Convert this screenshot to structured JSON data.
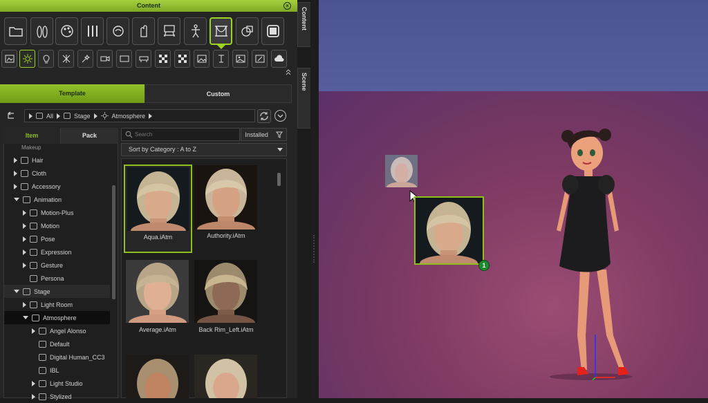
{
  "window": {
    "title": "Content"
  },
  "side_tabs": [
    "Content",
    "Scene"
  ],
  "category_icons": [
    "folder-icon",
    "bowling-pins-icon",
    "palette-icon",
    "brushes-icon",
    "head-profile-icon",
    "hand-icon",
    "stage-icon",
    "stick-figure-icon",
    "stage-frame-icon",
    "shapes-icon",
    "square-frame-icon"
  ],
  "sub_icons": [
    "scene-icon",
    "sun-icon",
    "lamp-icon",
    "sparkle-icon",
    "effects-icon",
    "camera-icon",
    "screen-icon",
    "props-icon",
    "checker-icon",
    "checker-icon",
    "image-icon",
    "text-icon",
    "image-icon",
    "edit-image-icon",
    "cloud-icon"
  ],
  "tabs": {
    "template": "Template",
    "custom": "Custom"
  },
  "breadcrumb": [
    "All",
    "Stage",
    "Atmosphere"
  ],
  "left_tabs": {
    "item": "Item",
    "pack": "Pack"
  },
  "search": {
    "placeholder": "Search",
    "installed": "Installed"
  },
  "sort": {
    "label": "Sort by Category : A to Z"
  },
  "tree": {
    "partial_top": "Makeup",
    "items": [
      {
        "label": "Hair",
        "depth": 0,
        "state": "collapsed"
      },
      {
        "label": "Cloth",
        "depth": 0,
        "state": "collapsed"
      },
      {
        "label": "Accessory",
        "depth": 0,
        "state": "collapsed"
      },
      {
        "label": "Animation",
        "depth": 0,
        "state": "expanded"
      },
      {
        "label": "Motion-Plus",
        "depth": 1,
        "state": "collapsed"
      },
      {
        "label": "Motion",
        "depth": 1,
        "state": "collapsed"
      },
      {
        "label": "Pose",
        "depth": 1,
        "state": "collapsed"
      },
      {
        "label": "Expression",
        "depth": 1,
        "state": "collapsed"
      },
      {
        "label": "Gesture",
        "depth": 1,
        "state": "collapsed"
      },
      {
        "label": "Persona",
        "depth": 1,
        "state": "none"
      },
      {
        "label": "Stage",
        "depth": 0,
        "state": "expanded"
      },
      {
        "label": "Light Room",
        "depth": 1,
        "state": "collapsed"
      },
      {
        "label": "Atmosphere",
        "depth": 1,
        "state": "expanded",
        "selected": true
      },
      {
        "label": "Angel Alonso",
        "depth": 2,
        "state": "collapsed"
      },
      {
        "label": "Default",
        "depth": 2,
        "state": "none"
      },
      {
        "label": "Digital Human_CC3",
        "depth": 2,
        "state": "none"
      },
      {
        "label": "IBL",
        "depth": 2,
        "state": "none"
      },
      {
        "label": "Light Studio",
        "depth": 2,
        "state": "collapsed"
      },
      {
        "label": "Stylized",
        "depth": 2,
        "state": "collapsed"
      }
    ]
  },
  "tiles": [
    {
      "label": "Aqua.iAtm",
      "selected": true
    },
    {
      "label": "Authority.iAtm",
      "selected": false
    },
    {
      "label": "Average.iAtm",
      "selected": false
    },
    {
      "label": "Back Rim_Left.iAtm",
      "selected": false
    }
  ],
  "drag": {
    "count": "1"
  },
  "colors": {
    "accent": "#8fbf1c",
    "viewport_top": "#52589a",
    "viewport_bottom": "#8a3f69"
  }
}
